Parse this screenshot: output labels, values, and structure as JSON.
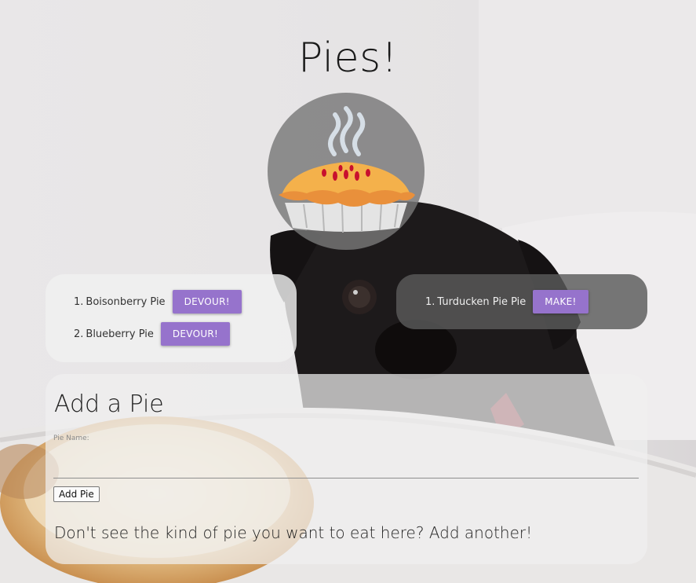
{
  "page": {
    "title": "Pies!"
  },
  "icons": {
    "logo": "pie-icon",
    "background": "pug-photo"
  },
  "eat_list": {
    "items": [
      {
        "number": "1.",
        "name": "Boisonberry Pie",
        "action": "DEVOUR!"
      },
      {
        "number": "2.",
        "name": "Blueberry Pie",
        "action": "DEVOUR!"
      }
    ]
  },
  "make_list": {
    "items": [
      {
        "number": "1.",
        "name": "Turducken Pie Pie",
        "action": "MAKE!"
      }
    ]
  },
  "form": {
    "heading": "Add a Pie",
    "field_label": "Pie Name:",
    "field_value": "",
    "submit_label": "Add Pie",
    "footer_text": "Don't see the kind of pie you want to eat here? Add another!"
  },
  "colors": {
    "accent": "#9673cc",
    "panel_light": "#f0f0f0",
    "panel_dark": "#5a5a5a"
  }
}
